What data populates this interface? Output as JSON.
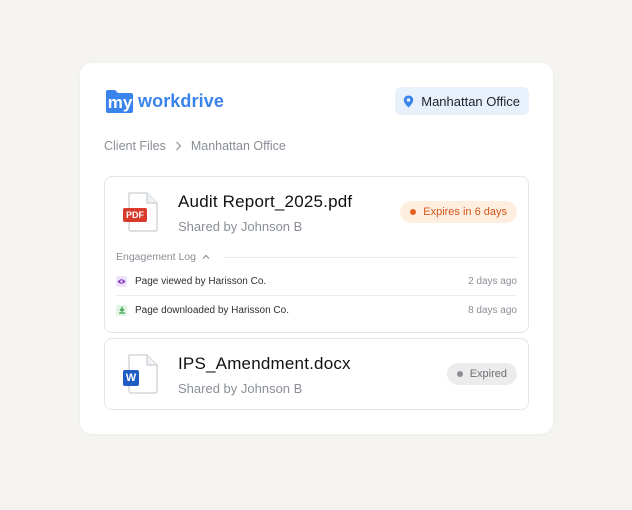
{
  "brand": {
    "logo_my": "my",
    "logo_text": "workdrive",
    "accent": "#3a83ec"
  },
  "location_chip": {
    "icon": "map-pin-icon",
    "label": "Manhattan Office"
  },
  "breadcrumb": {
    "items": [
      "Client Files",
      "Manhattan Office"
    ],
    "separator_icon": "chevron-right-icon"
  },
  "files": [
    {
      "name": "Audit Report_2025.pdf",
      "shared_by": "Shared by Johnson B",
      "type_badge": "PDF",
      "type_icon": "pdf-file-icon",
      "status": {
        "label": "Expires in 6 days",
        "color": "#e8601f"
      },
      "engagement_log": {
        "title": "Engagement Log",
        "entries": [
          {
            "icon": "eye-icon",
            "text": "Page viewed by Harisson Co.",
            "when": "2 days ago"
          },
          {
            "icon": "download-icon",
            "text": "Page downloaded by Harisson Co.",
            "when": "8 days ago"
          }
        ]
      }
    },
    {
      "name": "IPS_Amendment.docx",
      "shared_by": "Shared by Johnson B",
      "type_badge": "W",
      "type_icon": "word-file-icon",
      "status": {
        "label": "Expired",
        "color": "#8c8f93"
      }
    }
  ]
}
